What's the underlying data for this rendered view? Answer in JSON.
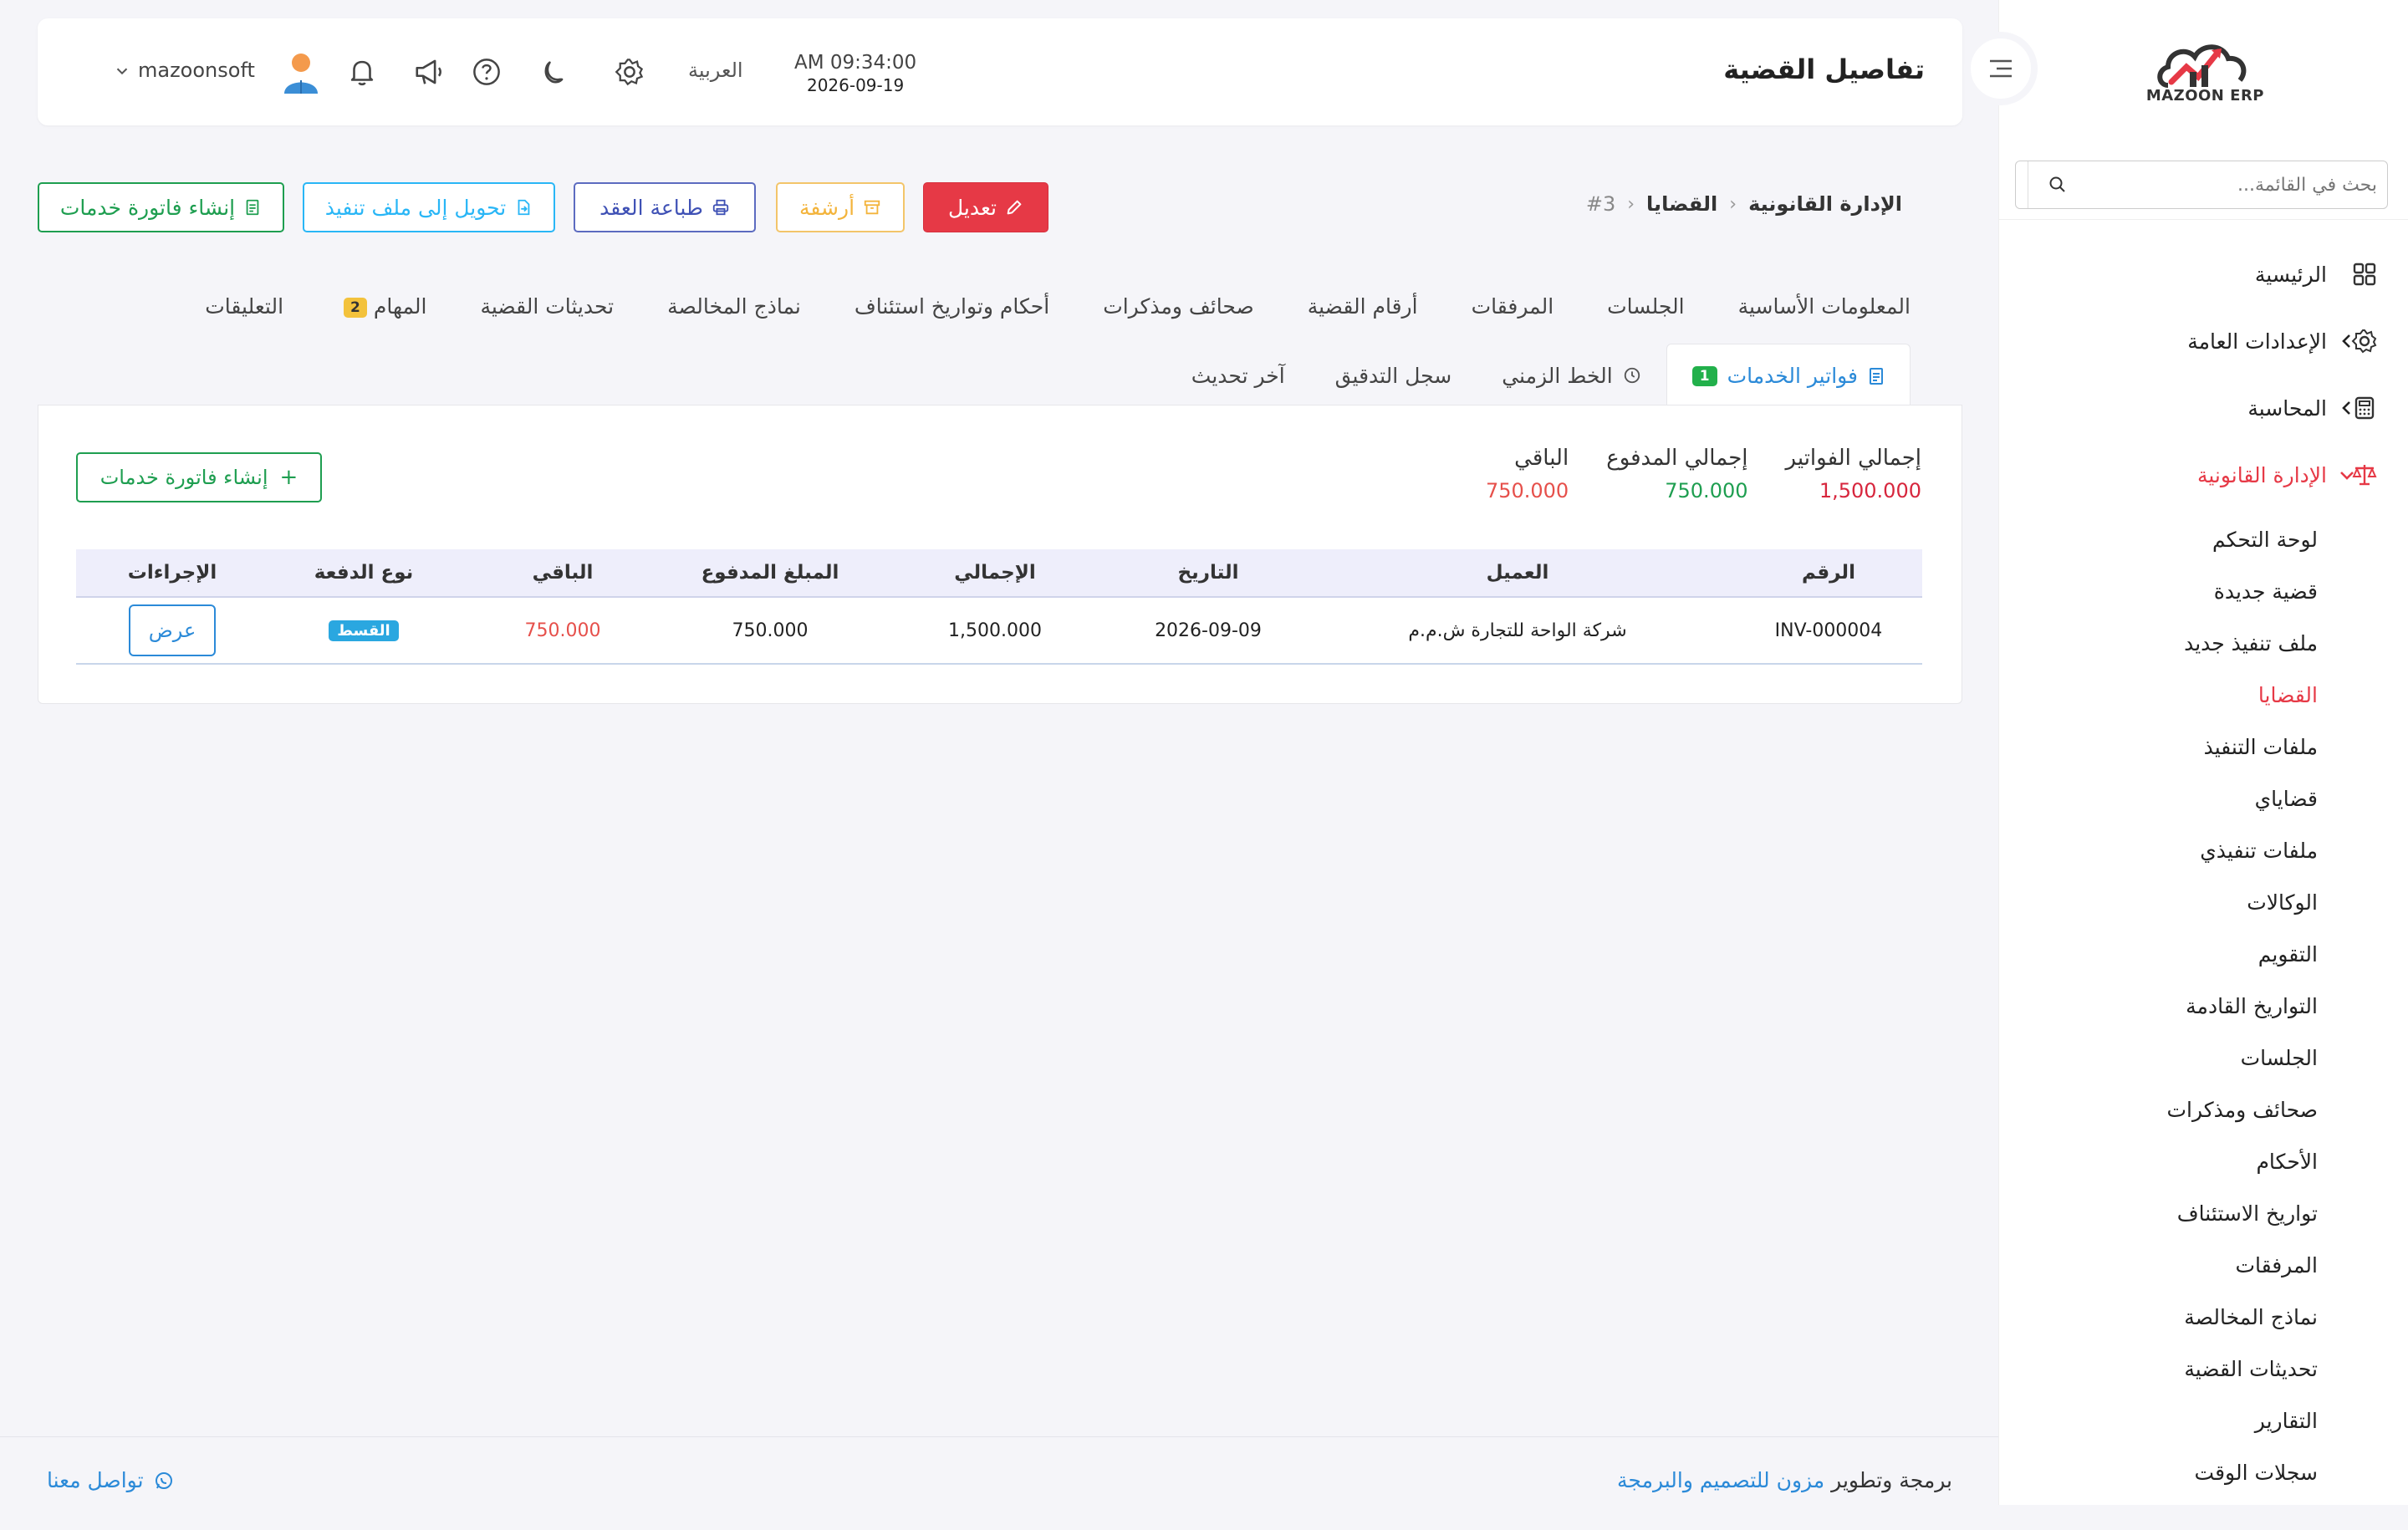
{
  "sidebar": {
    "logo_text": "MAZOON ERP",
    "search_placeholder": "بحث في القائمة...",
    "items": [
      {
        "label": "الرئيسية",
        "icon": "grid-icon"
      },
      {
        "label": "الإعدادات العامة",
        "icon": "gear-icon"
      },
      {
        "label": "المحاسبة",
        "icon": "calculator-icon"
      },
      {
        "label": "الإدارة القانونية",
        "icon": "scales-icon"
      }
    ],
    "sub_items": [
      "لوحة التحكم",
      "قضية جديدة",
      "ملف تنفيذ جديد",
      "القضايا",
      "ملفات التنفيذ",
      "قضاياي",
      "ملفات تنفيذي",
      "الوكالات",
      "التقويم",
      "التواريخ القادمة",
      "الجلسات",
      "صحائف ومذكرات",
      "الأحكام",
      "تواريخ الاستئناف",
      "المرفقات",
      "نماذج المخالصة",
      "تحديثات القضية",
      "التقارير",
      "سجلات الوقت"
    ]
  },
  "header": {
    "title": "تفاصيل القضية",
    "time": "AM 09:34:00",
    "date": "2026-09-19",
    "language": "العربية",
    "username": "mazoonsoft"
  },
  "breadcrumb": {
    "root": "الإدارة القانونية",
    "section": "القضايا",
    "id": "#3"
  },
  "actions": {
    "edit": "تعديل",
    "archive": "أرشفة",
    "print": "طباعة العقد",
    "convert": "تحويل إلى ملف تنفيذ",
    "invoice": "إنشاء فاتورة خدمات"
  },
  "tabs_row1": [
    "المعلومات الأساسية",
    "الجلسات",
    "المرفقات",
    "أرقام القضية",
    "صحائف ومذكرات",
    "أحكام وتواريخ استئناف",
    "نماذج المخالصة",
    "تحديثات القضية",
    "المهام",
    "التعليقات"
  ],
  "tasks_badge": "2",
  "tabs_row2": {
    "invoices": "فواتير الخدمات",
    "invoices_badge": "1",
    "timeline": "الخط الزمني",
    "audit": "سجل التدقيق",
    "last_update": "آخر تحديث"
  },
  "summary": {
    "total_label": "إجمالي الفواتير",
    "total_value": "1,500.000",
    "paid_label": "إجمالي المدفوع",
    "paid_value": "750.000",
    "remaining_label": "الباقي",
    "remaining_value": "750.000",
    "create_button": "إنشاء فاتورة خدمات"
  },
  "table": {
    "headers": [
      "الرقم",
      "العميل",
      "التاريخ",
      "الإجمالي",
      "المبلغ المدفوع",
      "الباقي",
      "نوع الدفعة",
      "الإجراءات"
    ],
    "rows": [
      {
        "number": "INV-000004",
        "client": "شركة الواحة للتجارة ش.م.م",
        "date": "2026-09-09",
        "total": "1,500.000",
        "paid": "750.000",
        "remaining": "750.000",
        "payment_type": "القسط",
        "action": "عرض"
      }
    ]
  },
  "footer": {
    "prefix": "برمجة وتطوير",
    "brand": "مزون للتصميم والبرمجة",
    "contact": "تواصل معنا"
  },
  "colors": {
    "accent_red": "#e63946",
    "green": "#1e9e50",
    "blue": "#2b8ad8",
    "warning": "#f3b43c"
  }
}
